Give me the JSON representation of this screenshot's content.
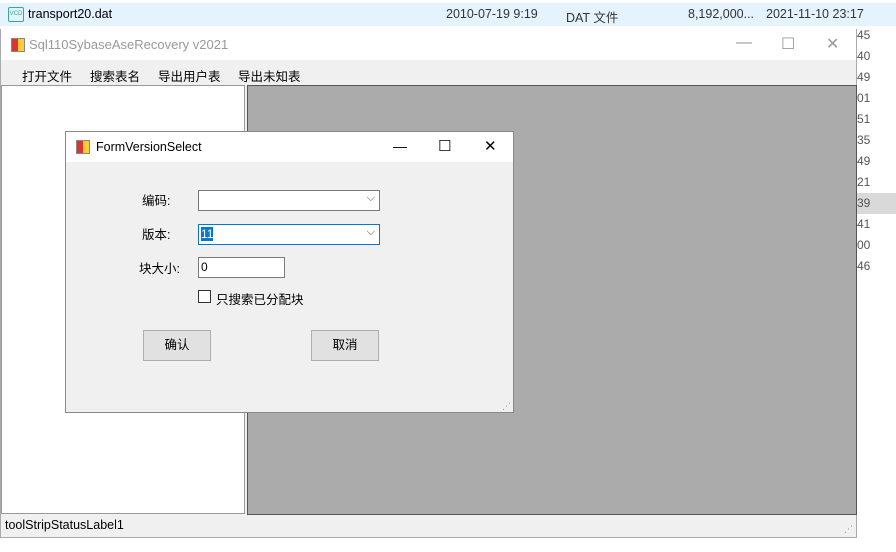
{
  "explorer": {
    "file_name": "transport20.dat",
    "modified": "2010-07-19 9:19",
    "type": "DAT 文件",
    "size": "8,192,000...",
    "date2": "2021-11-10 23:17",
    "side_numbers": [
      "45",
      "40",
      "49",
      "01",
      "51",
      "35",
      "49",
      "21",
      "39",
      "41",
      "00",
      "46"
    ]
  },
  "app": {
    "title": "Sql110SybaseAseRecovery v2021",
    "menu": [
      "打开文件",
      "搜索表名",
      "导出用户表",
      "导出未知表"
    ],
    "status": "toolStripStatusLabel1"
  },
  "dialog": {
    "title": "FormVersionSelect",
    "encoding_label": "编码:",
    "encoding_value": "",
    "version_label": "版本:",
    "version_value": "11",
    "block_size_label": "块大小:",
    "block_size_value": "0",
    "checkbox_label": "只搜索已分配块",
    "checkbox_checked": false,
    "ok": "确认",
    "cancel": "取消"
  }
}
